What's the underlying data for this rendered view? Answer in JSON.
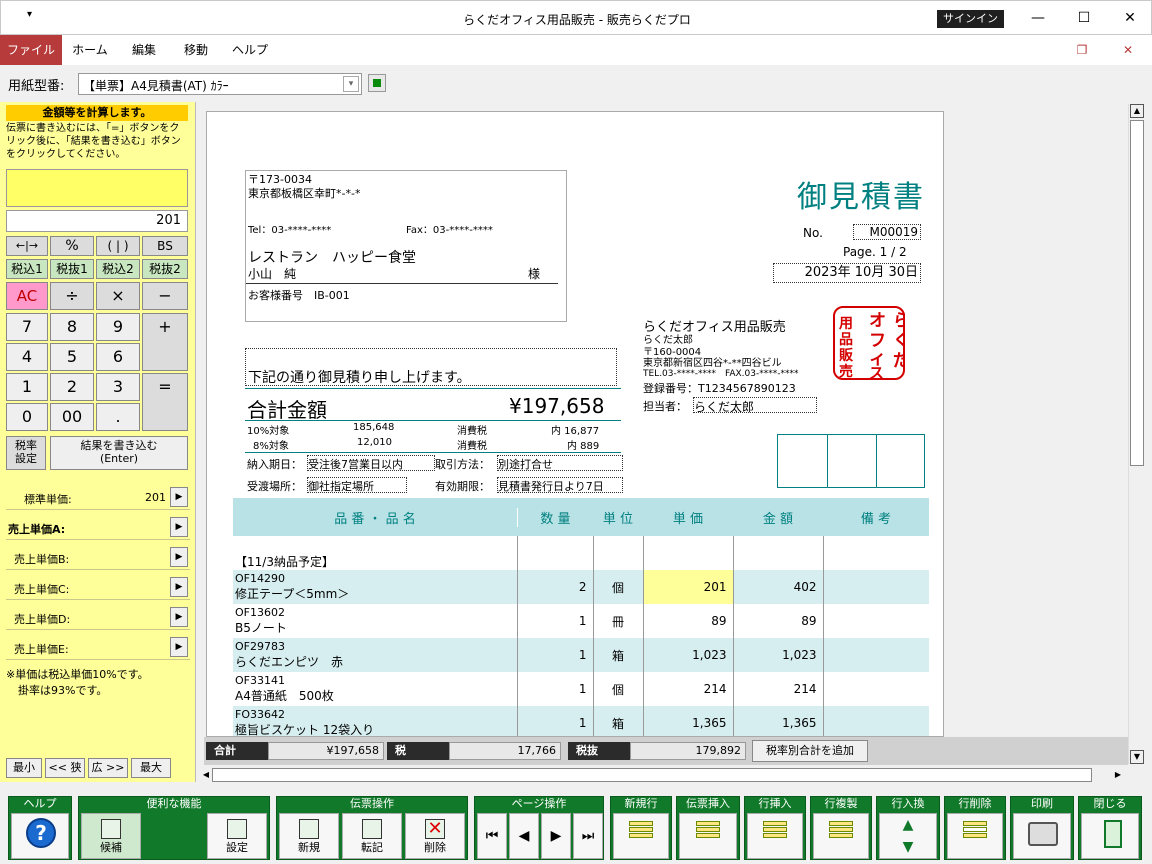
{
  "window": {
    "title": "らくだオフィス用品販売 - 販売らくだプロ",
    "signin": "サインイン"
  },
  "ribbon": {
    "tabs": [
      "ファイル",
      "ホーム",
      "編集",
      "移動",
      "ヘルプ"
    ]
  },
  "format": {
    "label": "用紙型番:",
    "value": "【単票】A4見積書(AT) ｶﾗｰ"
  },
  "calc": {
    "header": "金額等を計算します。",
    "desc": "伝票に書き込むには、「=」ボタンをクリック後に、「結果を書き込む」ボタンをクリックしてください。",
    "display": "201",
    "keys": {
      "arrows": "←|→",
      "pct": "%",
      "paren": "( | )",
      "bs": "BS",
      "tax_in1": "税込1",
      "tax_ex1": "税抜1",
      "tax_in2": "税込2",
      "tax_ex2": "税抜2",
      "ac": "AC",
      "div": "÷",
      "mul": "×",
      "minus": "−",
      "k7": "7",
      "k8": "8",
      "k9": "9",
      "plus": "+",
      "k4": "4",
      "k5": "5",
      "k6": "6",
      "k1": "1",
      "k2": "2",
      "k3": "3",
      "eq": "=",
      "k0": "0",
      "k00": "00",
      "dot": "."
    },
    "tax_setting": "税率\n設定",
    "write_result": "結果を書き込む\n(Enter)"
  },
  "prices": {
    "standard_label": "標準単価:",
    "standard_value": "201",
    "a": "売上単価A:",
    "b": "売上単価B:",
    "c": "売上単価C:",
    "d": "売上単価D:",
    "e": "売上単価E:",
    "note1": "※単価は税込単価10%です。",
    "note2": "掛率は93%です。"
  },
  "leftnav": {
    "min": "最小",
    "narrow": "<< 狭",
    "wide": "広 >>",
    "max": "最大"
  },
  "doc": {
    "zip": "〒173-0034",
    "addr": "東京都板橋区幸町*-*-*",
    "tel": "Tel：03-****-****",
    "fax": "Fax：03-****-****",
    "customer": "レストラン　ハッピー食堂",
    "person": "小山　純",
    "sama": "様",
    "cust_no": "お客様番号　IB-001",
    "title": "御見積書",
    "no_label": "No.",
    "no_value": "M00019",
    "page": "Page. 1 / 2",
    "date": "2023年 10月 30日",
    "company": "らくだオフィス用品販売",
    "company_person": "らくだ太郎",
    "company_zip": "〒160-0004",
    "company_addr": "東京都新宿区四谷*-**四谷ビル",
    "company_tel": "TEL.03-****-****　FAX.03-****-****",
    "reg_no": "登録番号：T1234567890123",
    "tantou_label": "担当者：",
    "tantou": "らくだ太郎",
    "stamp": "らくだオフィス用品販売",
    "greeting": "下記の通り御見積り申し上げます。",
    "total_label": "合計金額",
    "total": "¥197,658",
    "r10_label": "10%対象",
    "r10_val": "185,648",
    "r10_tax_label": "消費税",
    "r10_tax": "内 16,877",
    "r8_label": "8%対象",
    "r8_val": "12,010",
    "r8_tax_label": "消費税",
    "r8_tax": "内 889",
    "delivery_label": "納入期日：",
    "delivery": "受注後7営業日以内",
    "payment_label": "取引方法：",
    "payment": "別途打合せ",
    "place_label": "受渡場所：",
    "place": "御社指定場所",
    "valid_label": "有効期限：",
    "valid": "見積書発行日より7日",
    "col_name": "品 番 ・ 品 名",
    "col_qty": "数 量",
    "col_unit": "単 位",
    "col_price": "単 価",
    "col_amount": "金 額",
    "col_note": "備 考",
    "group": "【11/3納品予定】",
    "rows": [
      {
        "code": "OF14290",
        "name": "修正テープ＜5mm＞",
        "qty": "2",
        "unit": "個",
        "price": "201",
        "amount": "402"
      },
      {
        "code": "OF13602",
        "name": "B5ノート",
        "qty": "1",
        "unit": "冊",
        "price": "89",
        "amount": "89"
      },
      {
        "code": "OF29783",
        "name": "らくだエンピツ　赤",
        "qty": "1",
        "unit": "箱",
        "price": "1,023",
        "amount": "1,023"
      },
      {
        "code": "OF33141",
        "name": "A4普通紙　500枚",
        "qty": "1",
        "unit": "個",
        "price": "214",
        "amount": "214"
      },
      {
        "code": "FO33642",
        "name": "極旨ビスケット 12袋入り",
        "qty": "1",
        "unit": "箱",
        "price": "1,365",
        "amount": "1,365"
      }
    ]
  },
  "status": {
    "total_label": "合計",
    "total": "¥197,658",
    "tax_label": "税",
    "tax": "17,766",
    "ex_label": "税抜",
    "ex": "179,892",
    "add_btn": "税率別合計を追加"
  },
  "toolbar": {
    "help": "ヘルプ",
    "useful": "便利な機能",
    "complement": "候補",
    "settings": "設定",
    "slip": "伝票操作",
    "new": "新規",
    "transfer": "転記",
    "delete": "削除",
    "page": "ページ操作",
    "new_row": "新規行",
    "slip_insert": "伝票挿入",
    "row_insert": "行挿入",
    "row_copy": "行複製",
    "row_swap": "行入換",
    "row_delete": "行削除",
    "print": "印刷",
    "close": "閉じる"
  },
  "colors": {
    "accent": "#008080",
    "file_tab": "#b83b3b",
    "toolbar_green": "#117a2a",
    "calc_bg": "#ffff99",
    "row_hl": "#d7eef0",
    "stamp_red": "#d40000"
  }
}
